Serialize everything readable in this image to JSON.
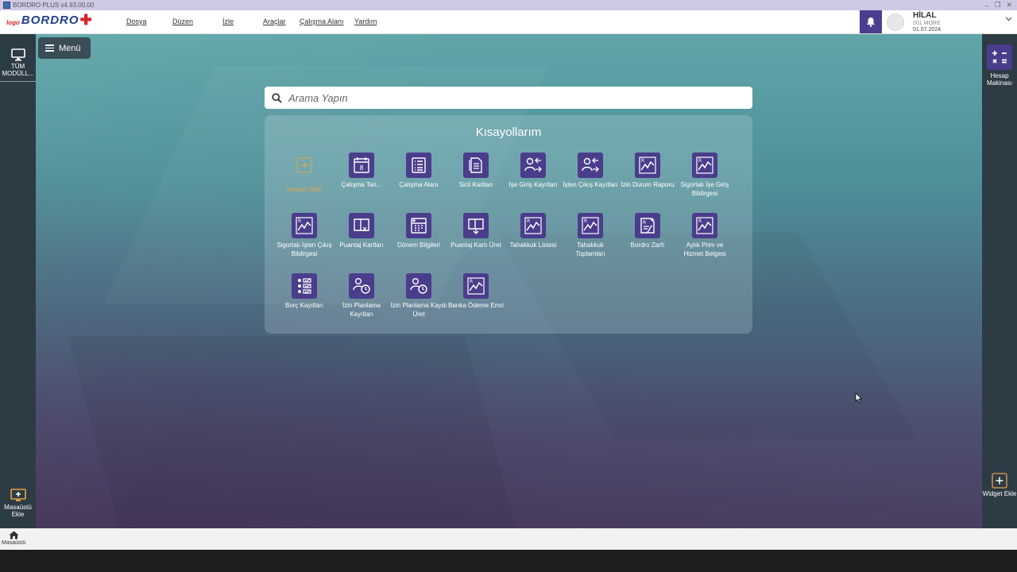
{
  "window": {
    "title": "BORDRO PLUS v4.93.00.00"
  },
  "logo": {
    "small": "logo",
    "big": "BORDRO"
  },
  "menu": [
    "Dosya",
    "Düzen",
    "İzle",
    "Araçlar",
    "Çalışma Alanı",
    "Yardım"
  ],
  "user": {
    "name": "HİLAL",
    "company": "001 MORE",
    "date": "01.07.2024"
  },
  "sidebar_left": {
    "all_modules": "TÜM MODÜLL...",
    "add_desktop": "Masaüstü Ekle"
  },
  "sidebar_right": {
    "calculator": "Hesap Makinası",
    "add_widget": "Widget Ekle"
  },
  "menu_button": "Menü",
  "search": {
    "placeholder": "Arama Yapın"
  },
  "shortcuts": {
    "title": "Kısayollarım",
    "add_label": "Kısayol Ekle",
    "items": [
      {
        "label": "Çalışma Tari...",
        "icon": "calendar-icon"
      },
      {
        "label": "Çalışma Alanı",
        "icon": "list-icon"
      },
      {
        "label": "Sicil Kartları",
        "icon": "documents-icon"
      },
      {
        "label": "İşe Giriş Kayıtları",
        "icon": "user-in-icon"
      },
      {
        "label": "İşten Çıkış Kayıtları",
        "icon": "user-out-icon"
      },
      {
        "label": "İzin Durum Raporu",
        "icon": "report-chart-icon"
      },
      {
        "label": "Sigortalı İşe Giriş Bildirgesi",
        "icon": "report-chart-icon"
      },
      {
        "label": "Sigortalı İşten Çıkış Bildirgesi",
        "icon": "report-chart-icon"
      },
      {
        "label": "Puantaj Kartları",
        "icon": "timesheet-icon"
      },
      {
        "label": "Dönem Bilgileri",
        "icon": "period-icon"
      },
      {
        "label": "Puantaj Kartı Üret",
        "icon": "timesheet-generate-icon"
      },
      {
        "label": "Tahakkuk Listesi",
        "icon": "report-chart-icon"
      },
      {
        "label": "Tahakkuk Toplamları",
        "icon": "report-chart-icon"
      },
      {
        "label": "Bordro Zarfı",
        "icon": "envelope-icon"
      },
      {
        "label": "Aylık Prim ve Hizmet Belgesi",
        "icon": "report-chart-icon"
      },
      {
        "label": "Borç Kayıtları",
        "icon": "checklist-icon"
      },
      {
        "label": "İzin Planlama Kayıtları",
        "icon": "leave-plan-icon"
      },
      {
        "label": "İzin Planlama Kaydı Üret",
        "icon": "leave-plan-icon"
      },
      {
        "label": "Banka Ödeme Emri",
        "icon": "report-chart-icon"
      }
    ]
  },
  "taskbar": {
    "home_label": "Masaüstü"
  },
  "colors": {
    "accent": "#4a3d8c",
    "rail": "#2d3b44",
    "add_orange": "#e3a547"
  }
}
